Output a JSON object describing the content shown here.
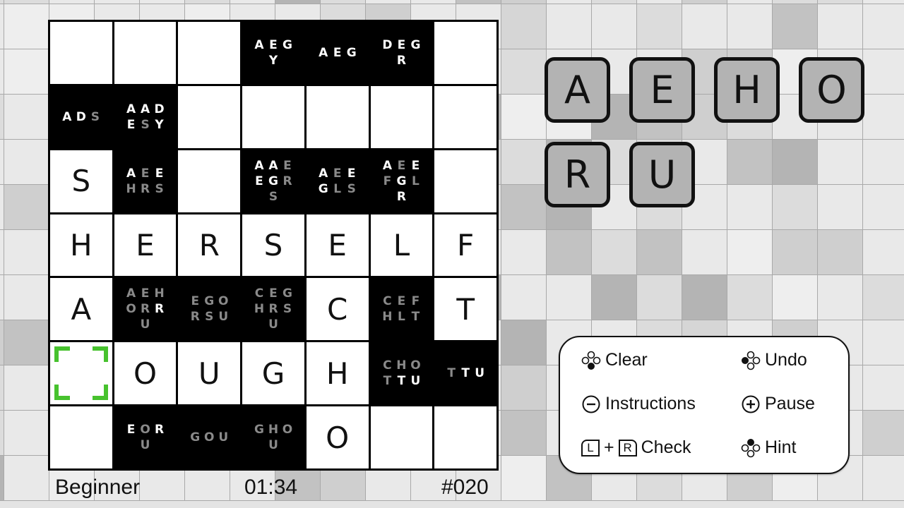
{
  "status_bar": {
    "difficulty": "Beginner",
    "timer": "01:34",
    "puzzle_number": "#020"
  },
  "colors": {
    "cursor": "#47c22e",
    "candidate_active": "#ffffff",
    "candidate_eliminated": "#8a8a8a",
    "tile_fill": "#b3b3b3"
  },
  "board": {
    "size": 7,
    "selected": {
      "row": 5,
      "col": 0
    },
    "rows": [
      [
        {
          "type": "white",
          "letter": ""
        },
        {
          "type": "white",
          "letter": ""
        },
        {
          "type": "white",
          "letter": ""
        },
        {
          "type": "black",
          "candidates": [
            {
              "l": "A",
              "s": "w"
            },
            {
              "l": "E",
              "s": "w"
            },
            {
              "l": "G",
              "s": "w"
            },
            {
              "l": "",
              "s": "w"
            },
            {
              "l": "Y",
              "s": "w"
            }
          ]
        },
        {
          "type": "black",
          "candidates": [
            {
              "l": "A",
              "s": "w"
            },
            {
              "l": "E",
              "s": "w"
            },
            {
              "l": "G",
              "s": "w"
            }
          ]
        },
        {
          "type": "black",
          "candidates": [
            {
              "l": "D",
              "s": "w"
            },
            {
              "l": "E",
              "s": "w"
            },
            {
              "l": "G",
              "s": "w"
            },
            {
              "l": "",
              "s": "w"
            },
            {
              "l": "R",
              "s": "w"
            }
          ]
        },
        {
          "type": "white",
          "letter": ""
        }
      ],
      [
        {
          "type": "black",
          "candidates": [
            {
              "l": "A",
              "s": "w"
            },
            {
              "l": "D",
              "s": "w"
            },
            {
              "l": "S",
              "s": "g"
            }
          ]
        },
        {
          "type": "black",
          "candidates": [
            {
              "l": "A",
              "s": "w"
            },
            {
              "l": "A",
              "s": "w"
            },
            {
              "l": "D",
              "s": "w"
            },
            {
              "l": "E",
              "s": "w"
            },
            {
              "l": "S",
              "s": "g"
            },
            {
              "l": "Y",
              "s": "w"
            }
          ]
        },
        {
          "type": "white",
          "letter": ""
        },
        {
          "type": "white",
          "letter": ""
        },
        {
          "type": "white",
          "letter": ""
        },
        {
          "type": "white",
          "letter": ""
        },
        {
          "type": "white",
          "letter": ""
        }
      ],
      [
        {
          "type": "white",
          "letter": "S"
        },
        {
          "type": "black",
          "candidates": [
            {
              "l": "A",
              "s": "w"
            },
            {
              "l": "E",
              "s": "g"
            },
            {
              "l": "E",
              "s": "w"
            },
            {
              "l": "H",
              "s": "g"
            },
            {
              "l": "R",
              "s": "g"
            },
            {
              "l": "S",
              "s": "g"
            }
          ]
        },
        {
          "type": "white",
          "letter": ""
        },
        {
          "type": "black",
          "candidates": [
            {
              "l": "A",
              "s": "w"
            },
            {
              "l": "A",
              "s": "w"
            },
            {
              "l": "E",
              "s": "g"
            },
            {
              "l": "E",
              "s": "w"
            },
            {
              "l": "G",
              "s": "w"
            },
            {
              "l": "R",
              "s": "g"
            },
            {
              "l": "",
              "s": "w"
            },
            {
              "l": "S",
              "s": "g"
            }
          ]
        },
        {
          "type": "black",
          "candidates": [
            {
              "l": "A",
              "s": "w"
            },
            {
              "l": "E",
              "s": "g"
            },
            {
              "l": "E",
              "s": "w"
            },
            {
              "l": "G",
              "s": "w"
            },
            {
              "l": "L",
              "s": "g"
            },
            {
              "l": "S",
              "s": "g"
            }
          ]
        },
        {
          "type": "black",
          "candidates": [
            {
              "l": "A",
              "s": "w"
            },
            {
              "l": "E",
              "s": "g"
            },
            {
              "l": "E",
              "s": "w"
            },
            {
              "l": "F",
              "s": "g"
            },
            {
              "l": "G",
              "s": "w"
            },
            {
              "l": "L",
              "s": "g"
            },
            {
              "l": "",
              "s": "w"
            },
            {
              "l": "R",
              "s": "w"
            }
          ]
        },
        {
          "type": "white",
          "letter": ""
        }
      ],
      [
        {
          "type": "white",
          "letter": "H"
        },
        {
          "type": "white",
          "letter": "E"
        },
        {
          "type": "white",
          "letter": "R"
        },
        {
          "type": "white",
          "letter": "S"
        },
        {
          "type": "white",
          "letter": "E"
        },
        {
          "type": "white",
          "letter": "L"
        },
        {
          "type": "white",
          "letter": "F"
        }
      ],
      [
        {
          "type": "white",
          "letter": "A"
        },
        {
          "type": "black",
          "candidates": [
            {
              "l": "A",
              "s": "g"
            },
            {
              "l": "E",
              "s": "g"
            },
            {
              "l": "H",
              "s": "g"
            },
            {
              "l": "O",
              "s": "g"
            },
            {
              "l": "R",
              "s": "g"
            },
            {
              "l": "R",
              "s": "w"
            },
            {
              "l": "",
              "s": "g"
            },
            {
              "l": "U",
              "s": "g"
            }
          ]
        },
        {
          "type": "black",
          "candidates": [
            {
              "l": "E",
              "s": "g"
            },
            {
              "l": "G",
              "s": "g"
            },
            {
              "l": "O",
              "s": "g"
            },
            {
              "l": "R",
              "s": "g"
            },
            {
              "l": "S",
              "s": "g"
            },
            {
              "l": "U",
              "s": "g"
            }
          ]
        },
        {
          "type": "black",
          "candidates": [
            {
              "l": "C",
              "s": "g"
            },
            {
              "l": "E",
              "s": "g"
            },
            {
              "l": "G",
              "s": "g"
            },
            {
              "l": "H",
              "s": "g"
            },
            {
              "l": "R",
              "s": "g"
            },
            {
              "l": "S",
              "s": "g"
            },
            {
              "l": "",
              "s": "g"
            },
            {
              "l": "U",
              "s": "g"
            }
          ]
        },
        {
          "type": "white",
          "letter": "C"
        },
        {
          "type": "black",
          "candidates": [
            {
              "l": "C",
              "s": "g"
            },
            {
              "l": "E",
              "s": "g"
            },
            {
              "l": "F",
              "s": "g"
            },
            {
              "l": "H",
              "s": "g"
            },
            {
              "l": "L",
              "s": "g"
            },
            {
              "l": "T",
              "s": "g"
            }
          ]
        },
        {
          "type": "white",
          "letter": "T"
        }
      ],
      [
        {
          "type": "white",
          "letter": ""
        },
        {
          "type": "white",
          "letter": "O"
        },
        {
          "type": "white",
          "letter": "U"
        },
        {
          "type": "white",
          "letter": "G"
        },
        {
          "type": "white",
          "letter": "H"
        },
        {
          "type": "black",
          "candidates": [
            {
              "l": "C",
              "s": "g"
            },
            {
              "l": "H",
              "s": "g"
            },
            {
              "l": "O",
              "s": "g"
            },
            {
              "l": "T",
              "s": "g"
            },
            {
              "l": "T",
              "s": "w"
            },
            {
              "l": "U",
              "s": "w"
            }
          ]
        },
        {
          "type": "black",
          "candidates": [
            {
              "l": "T",
              "s": "g"
            },
            {
              "l": "T",
              "s": "w"
            },
            {
              "l": "U",
              "s": "w"
            }
          ]
        }
      ],
      [
        {
          "type": "white",
          "letter": ""
        },
        {
          "type": "black",
          "candidates": [
            {
              "l": "E",
              "s": "w"
            },
            {
              "l": "O",
              "s": "g"
            },
            {
              "l": "R",
              "s": "w"
            },
            {
              "l": "",
              "s": "g"
            },
            {
              "l": "U",
              "s": "g"
            }
          ]
        },
        {
          "type": "black",
          "candidates": [
            {
              "l": "G",
              "s": "g"
            },
            {
              "l": "O",
              "s": "g"
            },
            {
              "l": "U",
              "s": "g"
            }
          ]
        },
        {
          "type": "black",
          "candidates": [
            {
              "l": "G",
              "s": "g"
            },
            {
              "l": "H",
              "s": "g"
            },
            {
              "l": "O",
              "s": "g"
            },
            {
              "l": "",
              "s": "g"
            },
            {
              "l": "U",
              "s": "g"
            }
          ]
        },
        {
          "type": "white",
          "letter": "O"
        },
        {
          "type": "white",
          "letter": ""
        },
        {
          "type": "white",
          "letter": ""
        }
      ]
    ]
  },
  "letter_tray": [
    "A",
    "E",
    "H",
    "O",
    "R",
    "U"
  ],
  "controls": [
    {
      "label": "Clear",
      "icon": "button-b-icon"
    },
    {
      "label": "Undo",
      "icon": "button-y-icon"
    },
    {
      "label": "Instructions",
      "icon": "minus-button-icon"
    },
    {
      "label": "Pause",
      "icon": "plus-button-icon"
    },
    {
      "label": "Check",
      "icon": "l-plus-r-icon",
      "key_left": "L",
      "key_plus": "+",
      "key_right": "R"
    },
    {
      "label": "Hint",
      "icon": "button-x-icon"
    }
  ]
}
